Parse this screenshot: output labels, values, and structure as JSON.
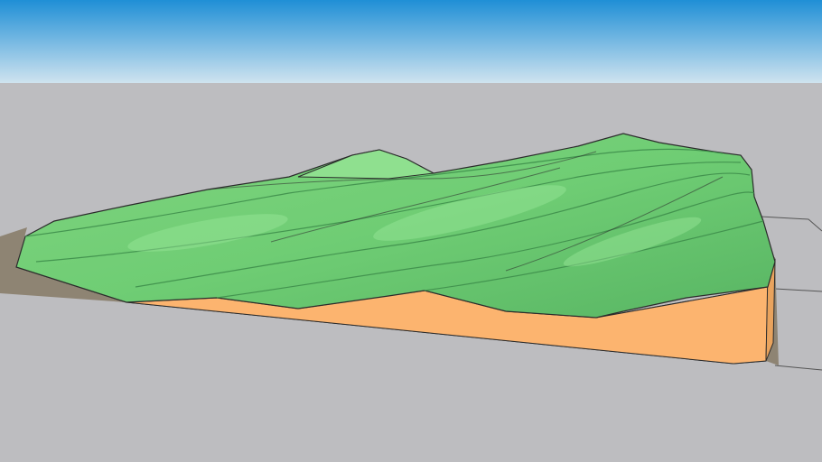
{
  "scene": {
    "description_type": "3d-terrain-model-render",
    "colors": {
      "sky_top": "#1f8fd6",
      "sky_bottom": "#cfe3ef",
      "ground": "#bdbdc0",
      "shadow": "#8e8473",
      "terrain_green_light": "#8fe08f",
      "terrain_green_mid": "#63c06b",
      "terrain_green_dark": "#3f8f4c",
      "base_orange": "#fcb46f",
      "edge_line": "#2b2b2b"
    }
  }
}
